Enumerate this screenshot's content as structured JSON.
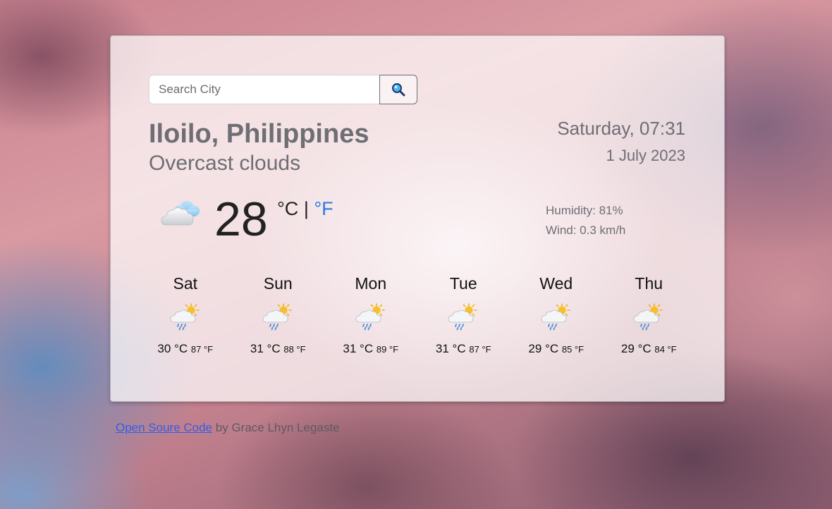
{
  "search": {
    "placeholder": "Search City",
    "button_icon": "search-icon"
  },
  "location": {
    "city": "Iloilo, Philippines",
    "description": "Overcast clouds"
  },
  "time": {
    "datetime": "Saturday, 07:31",
    "date": "1 July 2023"
  },
  "current": {
    "icon": "cloud-icon",
    "temperature": "28",
    "unit_c": "°C",
    "separator": "|",
    "unit_f": "°F",
    "humidity": "Humidity: 81%",
    "wind": "Wind: 0.3 km/h"
  },
  "forecast": [
    {
      "day": "Sat",
      "icon": "sun-cloud-rain-icon",
      "temp_c": "30 °C",
      "temp_f": "87 °F"
    },
    {
      "day": "Sun",
      "icon": "sun-cloud-rain-icon",
      "temp_c": "31 °C",
      "temp_f": "88 °F"
    },
    {
      "day": "Mon",
      "icon": "sun-cloud-rain-icon",
      "temp_c": "31 °C",
      "temp_f": "89 °F"
    },
    {
      "day": "Tue",
      "icon": "sun-cloud-rain-icon",
      "temp_c": "31 °C",
      "temp_f": "87 °F"
    },
    {
      "day": "Wed",
      "icon": "sun-cloud-rain-icon",
      "temp_c": "29 °C",
      "temp_f": "85 °F"
    },
    {
      "day": "Thu",
      "icon": "sun-cloud-rain-icon",
      "temp_c": "29 °C",
      "temp_f": "84 °F"
    }
  ],
  "footer": {
    "link_text": "Open Soure Code",
    "credit": " by Grace Lhyn Legaste"
  },
  "colors": {
    "accent_link": "#2f5fe6",
    "unit_active": "#2a7ae2",
    "muted_text": "#6e6e74"
  }
}
